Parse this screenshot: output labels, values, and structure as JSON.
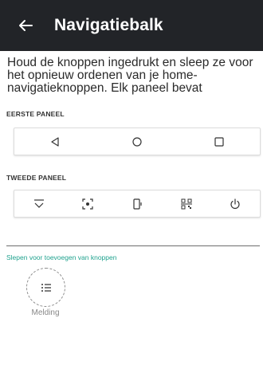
{
  "appbar": {
    "title": "Navigatiebalk"
  },
  "description": "Houd de knoppen ingedrukt en sleep ze voor het opnieuw ordenen van je home-navigatieknoppen. Elk paneel bevat",
  "panel1": {
    "label": "EERSTE PANEEL",
    "buttons": [
      "back-icon",
      "home-icon",
      "recents-icon"
    ]
  },
  "panel2": {
    "label": "TWEEDE PANEEL",
    "buttons": [
      "hide-navbar-icon",
      "screenshot-icon",
      "rotate-icon",
      "qr-scan-icon",
      "power-icon"
    ]
  },
  "drag": {
    "label": "Slepen voor toevoegen van knoppen",
    "items": [
      {
        "label": "Melding",
        "icon": "notification-list-icon"
      }
    ]
  },
  "colors": {
    "appbar": "#222428",
    "accent": "#1fa28e"
  }
}
